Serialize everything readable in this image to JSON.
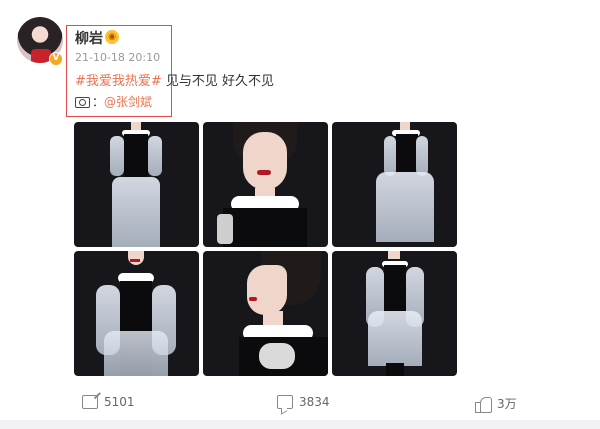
{
  "post": {
    "username": "柳岩",
    "verified_badge": "V",
    "timestamp": "21-10-18 20:10",
    "hashtag": "#我爱我热爱#",
    "text": " 见与不见 好久不见",
    "photo_credit_sep": "：",
    "photographer": "@张剑斌"
  },
  "photos": [
    {
      "name": "photo-1",
      "alt": "full-length dress look"
    },
    {
      "name": "photo-2",
      "alt": "close-up portrait"
    },
    {
      "name": "photo-3",
      "alt": "full-length tulle dress"
    },
    {
      "name": "photo-4",
      "alt": "dress with ruffled sleeves"
    },
    {
      "name": "photo-5",
      "alt": "side profile portrait"
    },
    {
      "name": "photo-6",
      "alt": "full-length dress back"
    }
  ],
  "actions": {
    "share_count": "5101",
    "comment_count": "3834",
    "like_count": "3万"
  },
  "colors": {
    "accent": "#eb7350",
    "highlight_border": "#e84a4a",
    "verified": "#f6a623"
  },
  "icons": [
    "camera-icon",
    "share-icon",
    "comment-icon",
    "like-icon",
    "emoji-icon"
  ]
}
